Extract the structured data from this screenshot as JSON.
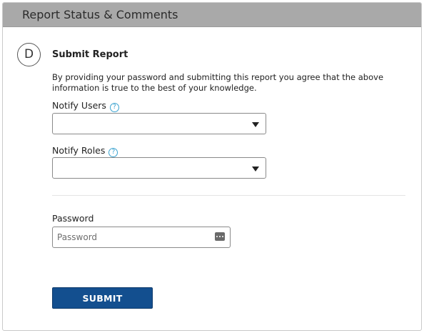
{
  "panel": {
    "title": "Report Status & Comments"
  },
  "section": {
    "step_letter": "D",
    "title": "Submit Report",
    "description": "By providing your password and submitting this report you agree that the above information is true to the best of your knowledge."
  },
  "notify_users": {
    "label": "Notify Users",
    "help_glyph": "?",
    "value": ""
  },
  "notify_roles": {
    "label": "Notify Roles",
    "help_glyph": "?",
    "value": ""
  },
  "password": {
    "label": "Password",
    "placeholder": "Password",
    "value": ""
  },
  "submit": {
    "label": "SUBMIT"
  },
  "icons": {
    "help": "question-circle-icon",
    "dropdown": "caret-down-icon",
    "password_manager": "password-key-icon"
  },
  "colors": {
    "header_bg": "#a9a9a9",
    "accent": "#3ba3d0",
    "submit_bg": "#134f8f"
  }
}
